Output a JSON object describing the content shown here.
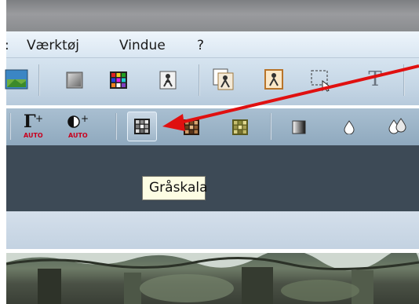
{
  "menu": {
    "items": [
      {
        "label": ":"
      },
      {
        "label": "Værktøj"
      },
      {
        "label": "Vindue"
      },
      {
        "label": "?"
      }
    ]
  },
  "toolbar2": {
    "gamma_auto": "AUTO",
    "contrast_auto": "AUTO",
    "gamma_symbol": "Γ",
    "plus": "+"
  },
  "toolbar1": {
    "text_tool_glyph": "T"
  },
  "tooltip": {
    "text": "Gråskala"
  },
  "colors": {
    "annotation_arrow": "#e01010",
    "tooltip_bg": "#fdfde3"
  },
  "icons": [
    "image-icon",
    "gray-square-icon",
    "color-grid-icon",
    "person-icon",
    "person-copy-icon",
    "person-frame-icon",
    "selection-icon",
    "text-icon",
    "gamma-auto-icon",
    "contrast-auto-icon",
    "grayscale-icon",
    "sepia-icon",
    "yellow-grid-icon",
    "gradient-icon",
    "droplet-icon",
    "droplets-icon"
  ]
}
